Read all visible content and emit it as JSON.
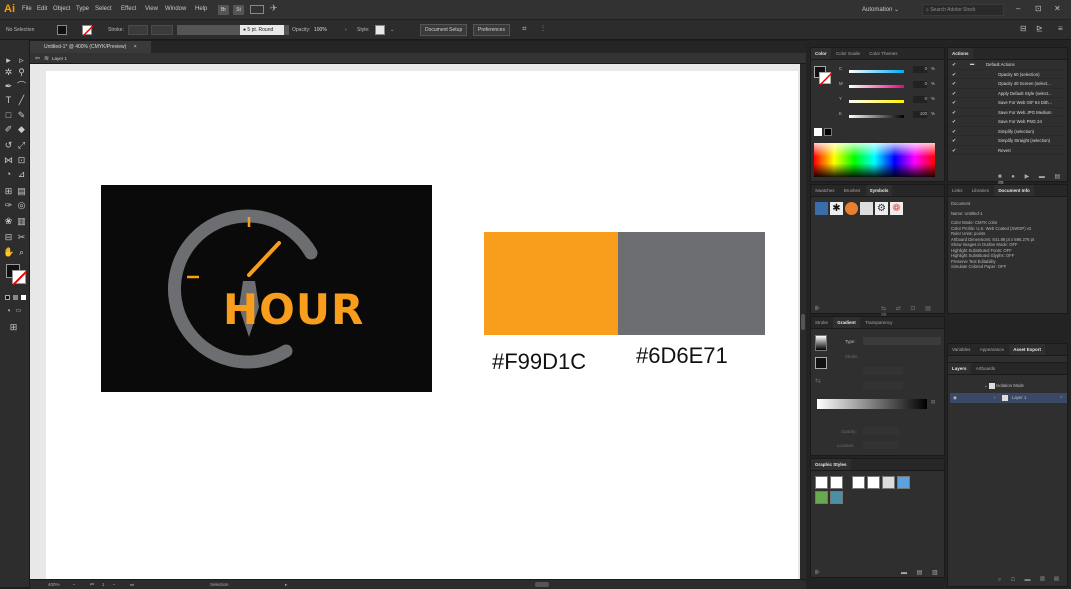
{
  "app": {
    "logo": "Ai",
    "menus": [
      "File",
      "Edit",
      "Object",
      "Type",
      "Select",
      "Effect",
      "View",
      "Window",
      "Help"
    ],
    "bridge_buttons": [
      "Br",
      "St"
    ],
    "workspace": "Automation",
    "search_placeholder": "Search Adobe Stock",
    "window_controls": [
      "–",
      "⊡",
      "✕"
    ]
  },
  "control_bar": {
    "selection": "No Selection",
    "stroke_label": "Stroke:",
    "brush": "5 pt. Round",
    "opacity_label": "Opacity:",
    "opacity_value": "100%",
    "style_label": "Style:",
    "document_setup": "Document Setup",
    "preferences": "Preferences"
  },
  "document": {
    "tab_title": "Untitled-1* @ 400% (CMYK/Preview)",
    "tab_close": "×",
    "layer_label": "Layer 1"
  },
  "artwork": {
    "logo_text": "HOUR",
    "colors": [
      {
        "hex_label": "#F99D1C",
        "color": "#f99d1c"
      },
      {
        "hex_label": "#6D6E71",
        "color": "#6d6e71"
      }
    ],
    "logo_orange": "#f99d1c",
    "logo_gray": "#6d6e71"
  },
  "status_bar": {
    "zoom": "400%",
    "artboard_num": "1",
    "tool": "Selection"
  },
  "panels": {
    "color_tabs": [
      "Color",
      "Color Guide",
      "Color Themes"
    ],
    "color_values": [
      "0",
      "0",
      "0",
      "100"
    ],
    "color_channels": [
      "C",
      "M",
      "Y",
      "K"
    ],
    "percent": "%",
    "actions_tab": "Actions",
    "actions": [
      {
        "label": "Default Actions",
        "folder": true
      },
      {
        "label": "Opacity 60 (selection)"
      },
      {
        "label": "Opacity 40 Screen (select..."
      },
      {
        "label": "Apply Default Style (select..."
      },
      {
        "label": "Save For Web GIF 64 Dith..."
      },
      {
        "label": "Save For Web JPG Medium"
      },
      {
        "label": "Save For Web PNG 24"
      },
      {
        "label": "Simplify (selection)"
      },
      {
        "label": "Simplify Straight (selection)"
      },
      {
        "label": "Revert"
      }
    ],
    "swatch_tabs": [
      "Swatches",
      "Brushes",
      "Symbols"
    ],
    "docinfo_tabs": [
      "Links",
      "Libraries",
      "Document Info"
    ],
    "docinfo_header": "Document",
    "docinfo_lines": [
      "Name: Untitled-1",
      "Color Mode: CMYK color",
      "Color Profile: U.S. Web Coated (SWOP) v2",
      "Ruler Units: points",
      "Artboard Dimensions: 841.89 pt x 595.276 pt",
      "Show Images in Outline Mode: OFF",
      "Highlight Substituted Fonts: OFF",
      "Highlight Substituted Glyphs: OFF",
      "Preserve Text Editability",
      "Simulate Colored Paper: OFF"
    ],
    "stroke_tabs": [
      "Stroke",
      "Gradient",
      "Transparency"
    ],
    "gradient_type": "Type:",
    "gradient_stroke": "Stroke:",
    "gradient_opacity": "Opacity:",
    "gradient_location": "Location:",
    "asset_tabs": [
      "Variables",
      "Appearance",
      "Asset Export"
    ],
    "layers_tabs": [
      "Layers",
      "Artboards"
    ],
    "layers": [
      {
        "label": "Isolation Mode"
      },
      {
        "label": "Layer 1"
      }
    ],
    "graphic_styles_tab": "Graphic Styles"
  }
}
